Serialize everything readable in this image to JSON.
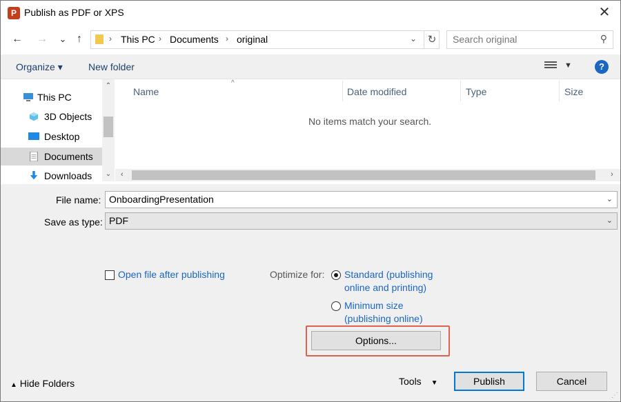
{
  "window": {
    "title": "Publish as PDF or XPS",
    "app_icon": "P"
  },
  "nav": {
    "back": "←",
    "forward": "→",
    "recent": "⌄",
    "up": "↑",
    "path": [
      "This PC",
      "Documents",
      "original"
    ],
    "search_placeholder": "Search original"
  },
  "toolbar": {
    "organize": "Organize ▾",
    "new_folder": "New folder",
    "help": "?"
  },
  "sidebar": {
    "items": [
      {
        "label": "This PC",
        "icon": "pc-icon"
      },
      {
        "label": "3D Objects",
        "icon": "cube-icon"
      },
      {
        "label": "Desktop",
        "icon": "desktop-icon"
      },
      {
        "label": "Documents",
        "icon": "documents-icon",
        "selected": true
      },
      {
        "label": "Downloads",
        "icon": "downloads-icon"
      }
    ]
  },
  "filelist": {
    "columns": [
      "Name",
      "Date modified",
      "Type",
      "Size"
    ],
    "empty_message": "No items match your search."
  },
  "form": {
    "file_name_label": "File name:",
    "file_name_value": "OnboardingPresentation",
    "save_type_label": "Save as type:",
    "save_type_value": "PDF"
  },
  "options": {
    "open_after_label": "Open file after publishing",
    "optimize_label": "Optimize for:",
    "standard_line1": "Standard (publishing",
    "standard_line2": "online and printing)",
    "minimum_line1": "Minimum size",
    "minimum_line2": "(publishing online)",
    "options_button": "Options..."
  },
  "footer": {
    "hide_folders": "Hide Folders",
    "tools": "Tools",
    "publish": "Publish",
    "cancel": "Cancel"
  },
  "colors": {
    "accent": "#0078d7",
    "link": "#1a66c2",
    "highlight": "#e0604e",
    "app": "#c43e1c"
  }
}
